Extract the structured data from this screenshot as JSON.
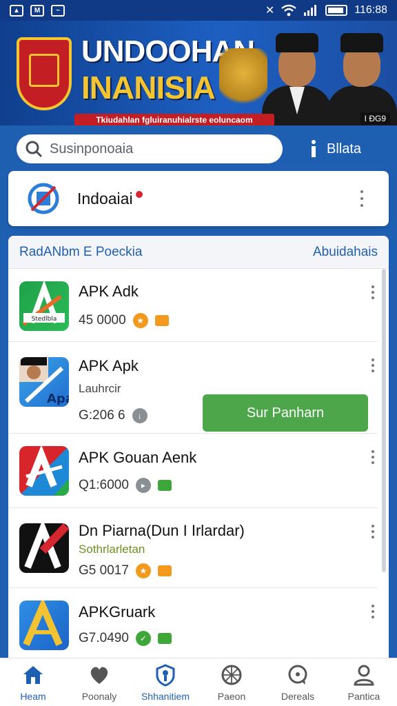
{
  "status_bar": {
    "time": "116:88"
  },
  "banner": {
    "title_line1": "UNDOOHAN",
    "title_line2": "INANISIA",
    "strip_text": "Tkiudahlan fgluiranuhialrste eoluncaom",
    "tag": "I ÐG9"
  },
  "search": {
    "placeholder": "Susinponoaia",
    "info_label": "Bllata"
  },
  "featured": {
    "title": "Indoaiai"
  },
  "list": {
    "header_left": "RadANbm E Poeckia",
    "header_right": "Abuidahais",
    "items": [
      {
        "title": "APK Adk",
        "subtitle": "",
        "meta": "45 0000",
        "icon_text": "Stedlbla"
      },
      {
        "title": "APK Apk",
        "subtitle": "Lauhrcir",
        "meta": "G:206 6",
        "icon_text": "Apa",
        "action": "Sur Panharn"
      },
      {
        "title": "APK Gouan Aenk",
        "subtitle": "",
        "meta": "Q1:6000",
        "icon_text": ""
      },
      {
        "title": "Dn Piarna(Dun I Irlardar)",
        "subtitle": "Sothrlarletan",
        "meta": "G5 0017",
        "icon_text": ""
      },
      {
        "title": "APKGruark",
        "subtitle": "",
        "meta": "G7.0490",
        "icon_text": ""
      }
    ]
  },
  "nav": {
    "items": [
      {
        "label": "Heam"
      },
      {
        "label": "Poonaly"
      },
      {
        "label": "Shhanitiem"
      },
      {
        "label": "Paeon"
      },
      {
        "label": "Dereals"
      },
      {
        "label": "Pantica"
      }
    ]
  },
  "colors": {
    "primary": "#1f5fb1",
    "install_green": "#4ea64a",
    "accent_red": "#c41e25",
    "accent_gold": "#f4c431"
  }
}
